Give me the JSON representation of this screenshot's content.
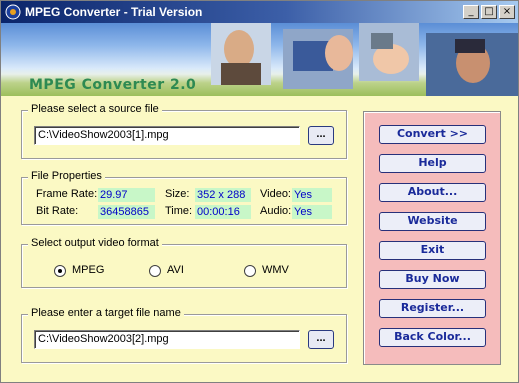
{
  "window": {
    "title": "MPEG Converter - Trial Version",
    "controls": {
      "minimize": "_",
      "maximize": "□",
      "close": "×"
    }
  },
  "banner": {
    "title": "MPEG Converter 2.0"
  },
  "source": {
    "group_label": "Please select a source file",
    "path": "C:\\VideoShow2003[1].mpg",
    "browse_label": "..."
  },
  "properties": {
    "group_label": "File Properties",
    "frame_rate_label": "Frame Rate:",
    "frame_rate": "29.97",
    "bit_rate_label": "Bit Rate:",
    "bit_rate": "36458865",
    "size_label": "Size:",
    "size": "352 x 288",
    "time_label": "Time:",
    "time": "00:00:16",
    "video_label": "Video:",
    "video": "Yes",
    "audio_label": "Audio:",
    "audio": "Yes"
  },
  "format": {
    "group_label": "Select output video format",
    "options": [
      "MPEG",
      "AVI",
      "WMV"
    ],
    "selected": "MPEG"
  },
  "target": {
    "group_label": "Please enter a target file name",
    "path": "C:\\VideoShow2003[2].mpg",
    "browse_label": "..."
  },
  "actions": {
    "convert": "Convert >>",
    "help": "Help",
    "about": "About...",
    "website": "Website",
    "exit": "Exit",
    "buy_now": "Buy Now",
    "register": "Register...",
    "back_color": "Back Color..."
  },
  "colors": {
    "window_bg": "#fbf9c4",
    "button_panel_bg": "#f5bcbc",
    "button_text": "#1a2a9a",
    "value_bg": "#c8f7c8",
    "value_text": "#0000c8",
    "banner_title": "#2e8a52"
  }
}
